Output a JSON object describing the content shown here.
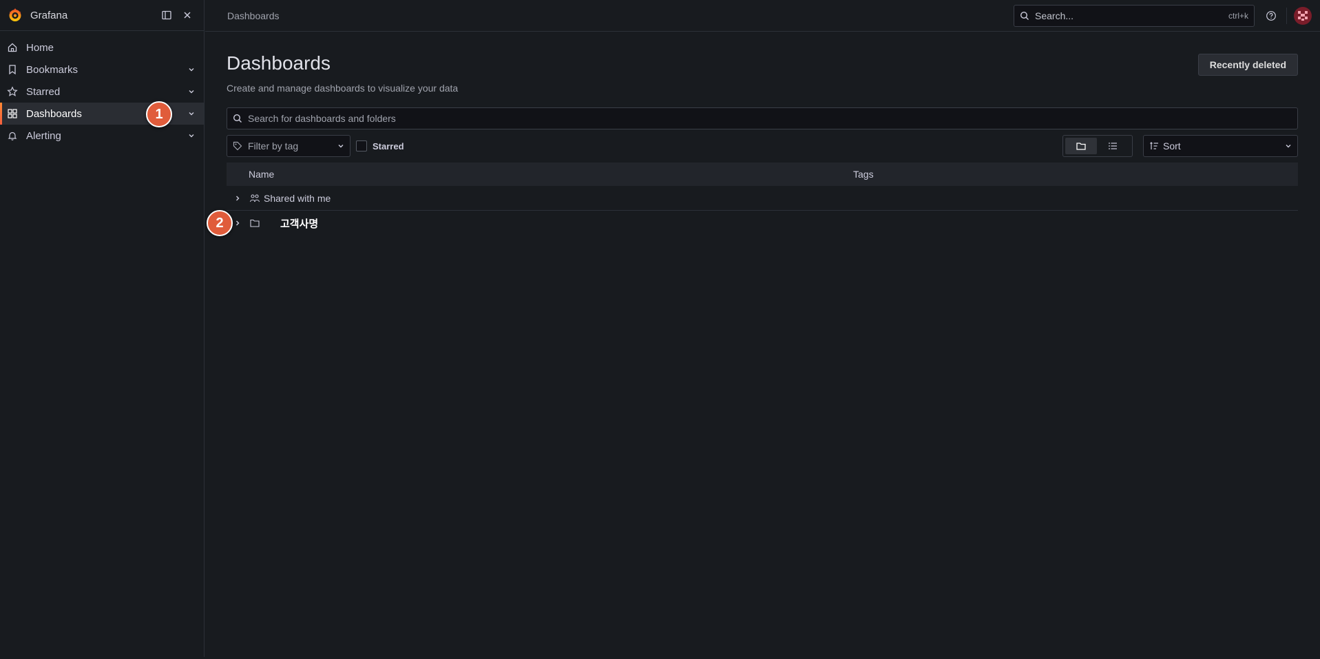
{
  "app": {
    "brand": "Grafana",
    "breadcrumb": "Dashboards"
  },
  "search": {
    "placeholder": "Search...",
    "shortcut": "ctrl+k"
  },
  "sidebar": {
    "items": [
      {
        "label": "Home",
        "icon": "home-icon"
      },
      {
        "label": "Bookmarks",
        "icon": "bookmark-icon"
      },
      {
        "label": "Starred",
        "icon": "star-icon"
      },
      {
        "label": "Dashboards",
        "icon": "apps-icon",
        "active": true
      },
      {
        "label": "Alerting",
        "icon": "bell-icon"
      }
    ]
  },
  "page": {
    "title": "Dashboards",
    "subtitle": "Create and manage dashboards to visualize your data",
    "recently_deleted": "Recently deleted",
    "search_placeholder": "Search for dashboards and folders",
    "filter_by_tag": "Filter by tag",
    "starred_label": "Starred",
    "sort_label": "Sort"
  },
  "table": {
    "headers": {
      "name": "Name",
      "tags": "Tags"
    },
    "rows": [
      {
        "label": "Shared with me",
        "icon": "users-icon"
      },
      {
        "label": "고객사명",
        "icon": "folder-icon"
      }
    ]
  },
  "annotations": {
    "badge1": "1",
    "badge2": "2"
  },
  "colors": {
    "accent": "#f55f3e",
    "badge": "#e05c3b",
    "background": "#181b1f"
  }
}
